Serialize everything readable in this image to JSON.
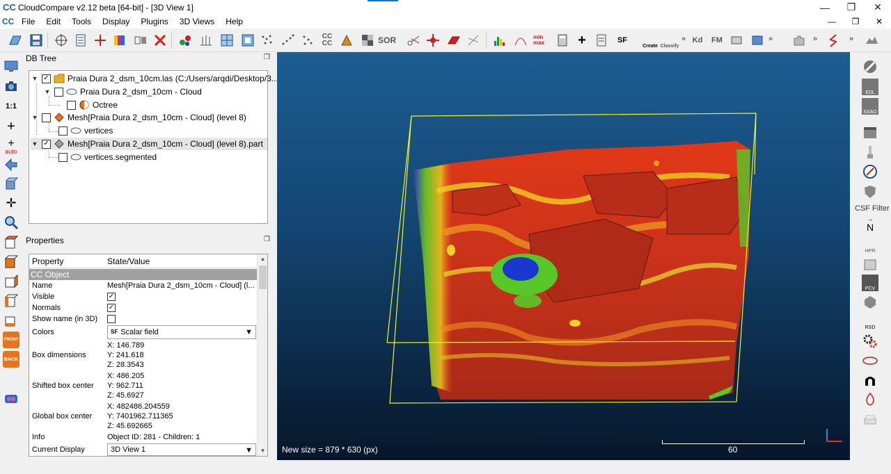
{
  "window": {
    "title": "CloudCompare v2.12 beta [64-bit] - [3D View 1]",
    "app_icon": "CC"
  },
  "menu": [
    "File",
    "Edit",
    "Tools",
    "Display",
    "Plugins",
    "3D Views",
    "Help"
  ],
  "toolbar": {
    "labels": {
      "cc": "CC",
      "sor": "SOR",
      "sf": "SF",
      "kd": "Kd",
      "fm": "FM",
      "create": "Create",
      "classify": "Classify",
      "minmax": "min max"
    }
  },
  "left_strip": {
    "scale_label": "1:1",
    "auto_label": "auto",
    "front_label": "FRONT",
    "back_label": "BACK"
  },
  "db_tree": {
    "title": "DB Tree",
    "nodes": [
      {
        "label": "Praia Dura 2_dsm_10cm.las (C:/Users/arqdi/Desktop/3...",
        "checked": "✓",
        "expanded": "▼"
      },
      {
        "label": "Praia Dura 2_dsm_10cm - Cloud",
        "checked": "",
        "expanded": "▼"
      },
      {
        "label": "Octree",
        "checked": "",
        "expanded": ""
      },
      {
        "label": "Mesh[Praia Dura 2_dsm_10cm - Cloud] (level 8)",
        "checked": "",
        "expanded": "▼"
      },
      {
        "label": "vertices",
        "checked": "",
        "expanded": ""
      },
      {
        "label": "Mesh[Praia Dura 2_dsm_10cm - Cloud] (level 8).part",
        "checked": "✓",
        "expanded": "▼",
        "selected": true
      },
      {
        "label": "vertices.segmented",
        "checked": "",
        "expanded": ""
      }
    ]
  },
  "properties": {
    "title": "Properties",
    "col_property": "Property",
    "col_value": "State/Value",
    "section": "CC Object",
    "name_label": "Name",
    "name_value": "Mesh[Praia Dura 2_dsm_10cm - Cloud] (l...",
    "visible_label": "Visible",
    "visible_value": "✓",
    "normals_label": "Normals",
    "normals_value": "✓",
    "showname_label": "Show name (in 3D)",
    "showname_value": "",
    "colors_label": "Colors",
    "colors_value": "Scalar field",
    "colors_icon": "SF",
    "box_label": "Box dimensions",
    "box_x": "X: 146.789",
    "box_y": "Y: 241.618",
    "box_z": "Z: 28.3543",
    "shifted_label": "Shifted box center",
    "shifted_x": "X: 486.205",
    "shifted_y": "Y: 962.711",
    "shifted_z": "Z: 45.6927",
    "global_label": "Global box center",
    "global_x": "X: 482486.204559",
    "global_y": "Y: 7401962.711365",
    "global_z": "Z: 45.692665",
    "info_label": "Info",
    "info_value": "Object ID: 281 - Children: 1",
    "display_label": "Current Display",
    "display_value": "3D View 1"
  },
  "view3d": {
    "status": "New size = 879 * 630 (px)",
    "scale_value": "60"
  },
  "right_strip": {
    "csf_label": "CSF Filter",
    "n_label": "N",
    "hpr": "HPR",
    "pcv": "PCV",
    "rsd": "RSD",
    "edl": "EDL",
    "ssao": "SSAO"
  },
  "colors": {
    "bbox": "#f4f41c",
    "mesh_red": "#c8321a",
    "mesh_orange": "#f07a10",
    "mesh_green": "#58c828",
    "mesh_blue": "#1a38d0"
  }
}
